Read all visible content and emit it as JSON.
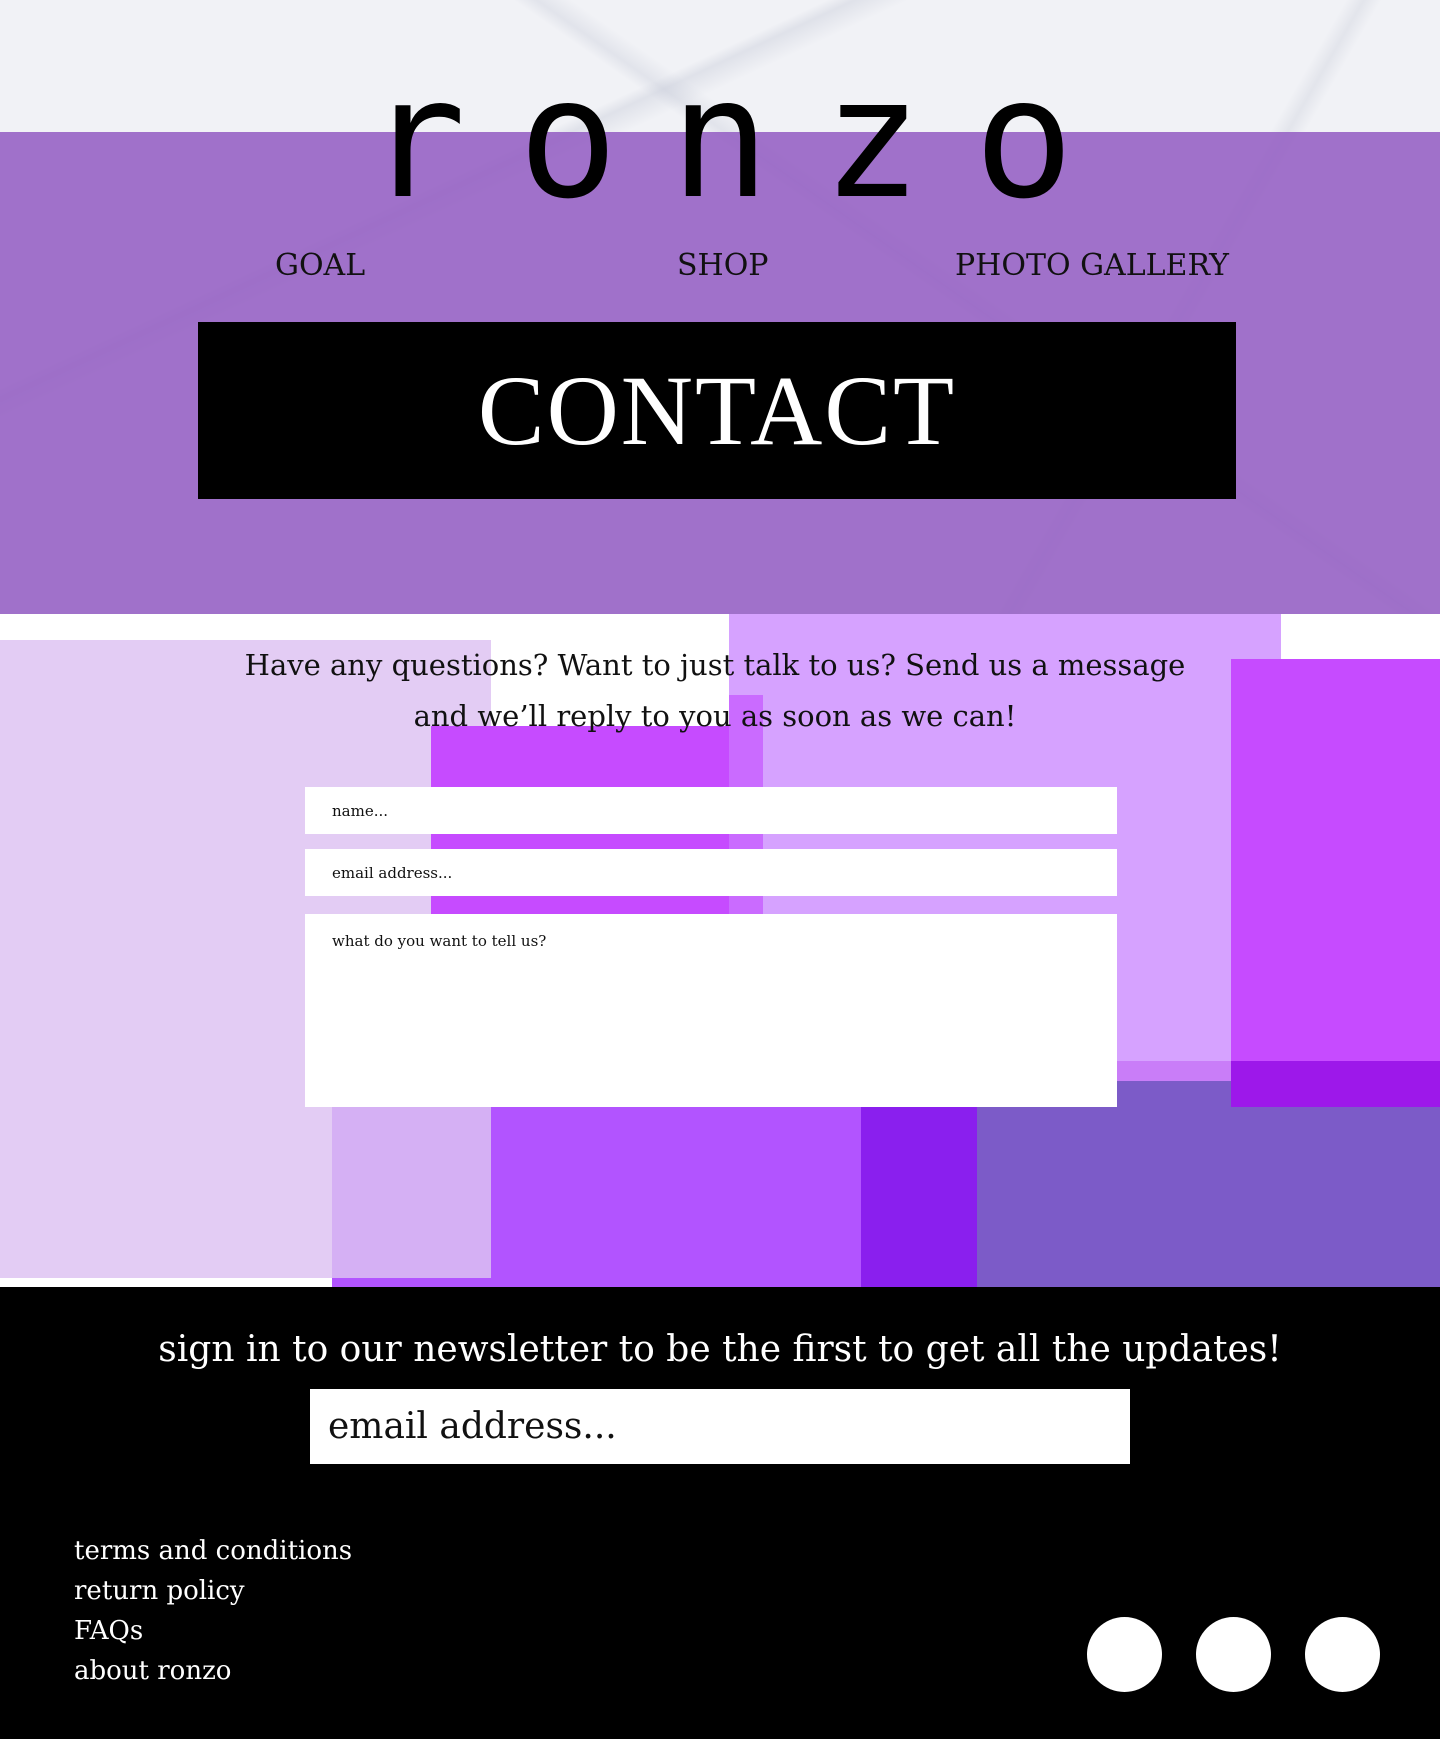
{
  "brand": {
    "logo": "ronzo"
  },
  "nav": [
    {
      "label": "GOAL"
    },
    {
      "label": "SHOP"
    },
    {
      "label": "PHOTO GALLERY"
    }
  ],
  "hero": {
    "title": "CONTACT"
  },
  "contact": {
    "intro_line1": "Have any questions? Want to just talk to us? Send us a message",
    "intro_line2": "and we’ll reply to you as soon as we can!",
    "name_placeholder": "name...",
    "email_placeholder": "email address...",
    "message_placeholder": "what do you want to tell us?"
  },
  "newsletter": {
    "text": "sign in to our newsletter to be the first to get all the updates!",
    "email_placeholder": "email address..."
  },
  "footer": {
    "links": [
      {
        "label": "terms and conditions"
      },
      {
        "label": "return policy"
      },
      {
        "label": "FAQs"
      },
      {
        "label": "about ronzo"
      }
    ],
    "social_icons": [
      "social-icon",
      "social-icon",
      "social-icon"
    ]
  },
  "colors": {
    "purple_band": "#935cc2",
    "accent_magenta": "#c64bff",
    "deep_violet": "#8a1fee",
    "footer_bg": "#000000"
  }
}
